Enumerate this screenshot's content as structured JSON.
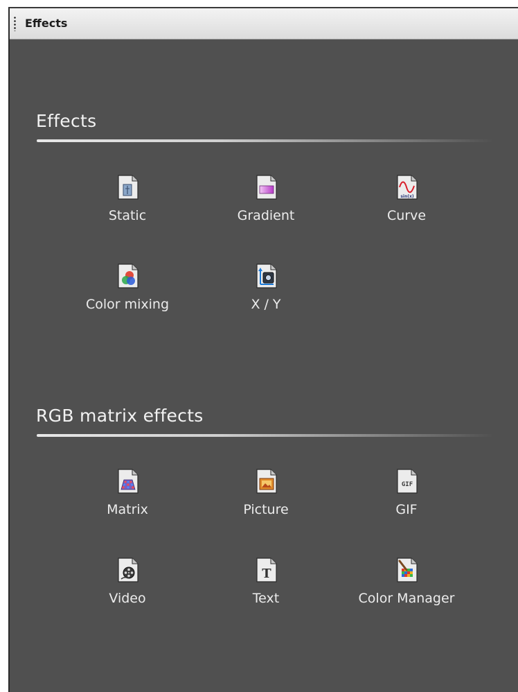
{
  "panel": {
    "title": "Effects"
  },
  "sections": [
    {
      "title": "Effects",
      "items": [
        {
          "label": "Static",
          "icon": "static-icon"
        },
        {
          "label": "Gradient",
          "icon": "gradient-icon"
        },
        {
          "label": "Curve",
          "icon": "curve-icon",
          "icon_text": "sin(x)"
        },
        {
          "label": "Color mixing",
          "icon": "color-mixing-icon"
        },
        {
          "label": "X / Y",
          "icon": "xy-icon"
        }
      ]
    },
    {
      "title": "RGB matrix effects",
      "items": [
        {
          "label": "Matrix",
          "icon": "matrix-icon"
        },
        {
          "label": "Picture",
          "icon": "picture-icon"
        },
        {
          "label": "GIF",
          "icon": "gif-icon",
          "icon_text": "GIF"
        },
        {
          "label": "Video",
          "icon": "video-icon"
        },
        {
          "label": "Text",
          "icon": "text-icon",
          "icon_text": "T"
        },
        {
          "label": "Color Manager",
          "icon": "color-manager-icon"
        }
      ]
    }
  ],
  "colors": {
    "panel_background": "#505050",
    "titlebar_background": "#e6e6e6",
    "label_text": "#ececec"
  }
}
